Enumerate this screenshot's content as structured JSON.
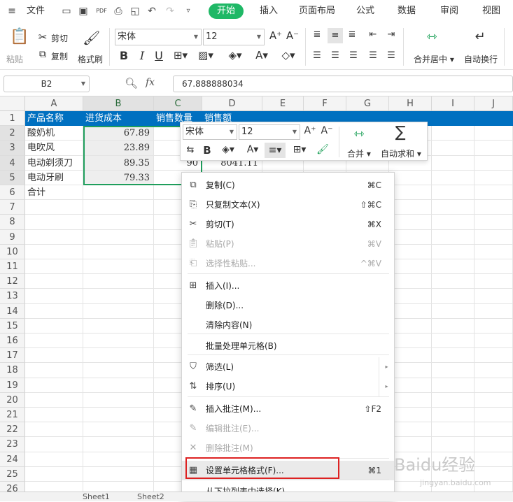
{
  "menu": {
    "file": "文件",
    "tabs": [
      "开始",
      "插入",
      "页面布局",
      "公式",
      "数据",
      "审阅",
      "视图"
    ],
    "active_tab": "开始",
    "accent_color": "#1fb866"
  },
  "ribbon": {
    "paste": "粘贴",
    "cut": "剪切",
    "copy": "复制",
    "format_painter": "格式刷",
    "font_name": "宋体",
    "font_size": "12",
    "bold": "B",
    "italic": "I",
    "underline": "U",
    "merge_center": "合并居中",
    "wrap_text": "自动换行"
  },
  "formula_bar": {
    "name_box": "B2",
    "fx": "fx",
    "value": "67.888888034"
  },
  "columns": [
    "A",
    "B",
    "C",
    "D",
    "E",
    "F",
    "G",
    "H",
    "I",
    "J"
  ],
  "rows": [
    "1",
    "2",
    "3",
    "4",
    "5",
    "6",
    "7",
    "8",
    "9",
    "10",
    "11",
    "12",
    "13",
    "14",
    "15",
    "16",
    "17",
    "18",
    "19",
    "20",
    "21",
    "22",
    "23",
    "24",
    "25",
    "26"
  ],
  "header_row": [
    "产品名称",
    "进货成本",
    "销售数量",
    "销售额"
  ],
  "data_rows": [
    {
      "name": "酸奶机",
      "cost": "67.89"
    },
    {
      "name": "电吹风",
      "cost": "23.89"
    },
    {
      "name": "电动剃须刀",
      "cost": "89.35",
      "qty": "90",
      "sales": "8041.11"
    },
    {
      "name": "电动牙刷",
      "cost": "79.33"
    }
  ],
  "total_label": "合计",
  "mini_toolbar": {
    "font_name": "宋体",
    "font_size": "12",
    "merge": "合并",
    "autosum": "自动求和"
  },
  "context_menu": {
    "items": [
      {
        "label": "复制(C)",
        "shortcut": "⌘C",
        "icon": "copy-icon"
      },
      {
        "label": "只复制文本(X)",
        "shortcut": "⇧⌘C",
        "icon": "copy-text-icon"
      },
      {
        "label": "剪切(T)",
        "shortcut": "⌘X",
        "icon": "scissors-icon"
      },
      {
        "label": "粘贴(P)",
        "shortcut": "⌘V",
        "icon": "paste-icon"
      },
      {
        "label": "选择性粘贴...",
        "shortcut": "^⌘V",
        "icon": "paste-special-icon"
      },
      {
        "label": "插入(I)...",
        "icon": "insert-icon"
      },
      {
        "label": "删除(D)..."
      },
      {
        "label": "清除内容(N)"
      },
      {
        "label": "批量处理单元格(B)"
      },
      {
        "label": "筛选(L)",
        "icon": "filter-icon"
      },
      {
        "label": "排序(U)",
        "icon": "sort-icon"
      },
      {
        "label": "插入批注(M)...",
        "shortcut": "⇧F2",
        "icon": "comment-icon"
      },
      {
        "label": "编辑批注(E)...",
        "icon": "edit-comment-icon"
      },
      {
        "label": "删除批注(M)",
        "icon": "delete-comment-icon"
      },
      {
        "label": "设置单元格格式(F)...",
        "shortcut": "⌘1",
        "icon": "format-cells-icon"
      },
      {
        "label": "从下拉列表中选择(K)..."
      }
    ]
  },
  "watermark": {
    "brand": "Baidu经验",
    "url": "jingyan.baidu.com"
  },
  "sheet_tabs": [
    "Sheet1",
    "Sheet2"
  ]
}
